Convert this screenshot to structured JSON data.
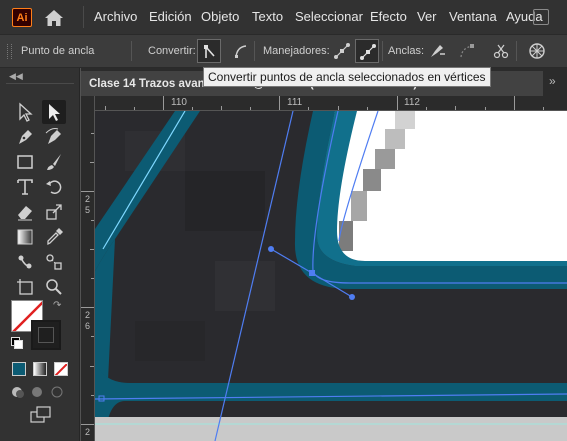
{
  "app": {
    "logo_text": "Ai"
  },
  "menu": [
    "Archivo",
    "Edición",
    "Objeto",
    "Texto",
    "Seleccionar",
    "Efecto",
    "Ver",
    "Ventana",
    "Ayuda"
  ],
  "control_bar": {
    "selection_label": "Punto de ancla",
    "convert_label": "Convertir:",
    "handles_label": "Manejadores:",
    "anchors_label": "Anclas:"
  },
  "tooltip": "Convertir puntos de ancla seleccionados en vértices",
  "document_tab": {
    "title": "Clase 14 Trazos avanzados.ai @ 9600 % (RGB/Previsualizar)"
  },
  "ruler": {
    "h_labels": [
      "110",
      "111",
      "112"
    ],
    "v_labels": [
      [
        "2",
        "5"
      ],
      [
        "2",
        "6"
      ],
      [
        "2"
      ]
    ]
  },
  "colors": {
    "fill_swatch": "none",
    "stroke_swatch": "#1f1f1f",
    "artwork_stroke": "#0c5b73",
    "path_selection": "#4f7df2"
  }
}
